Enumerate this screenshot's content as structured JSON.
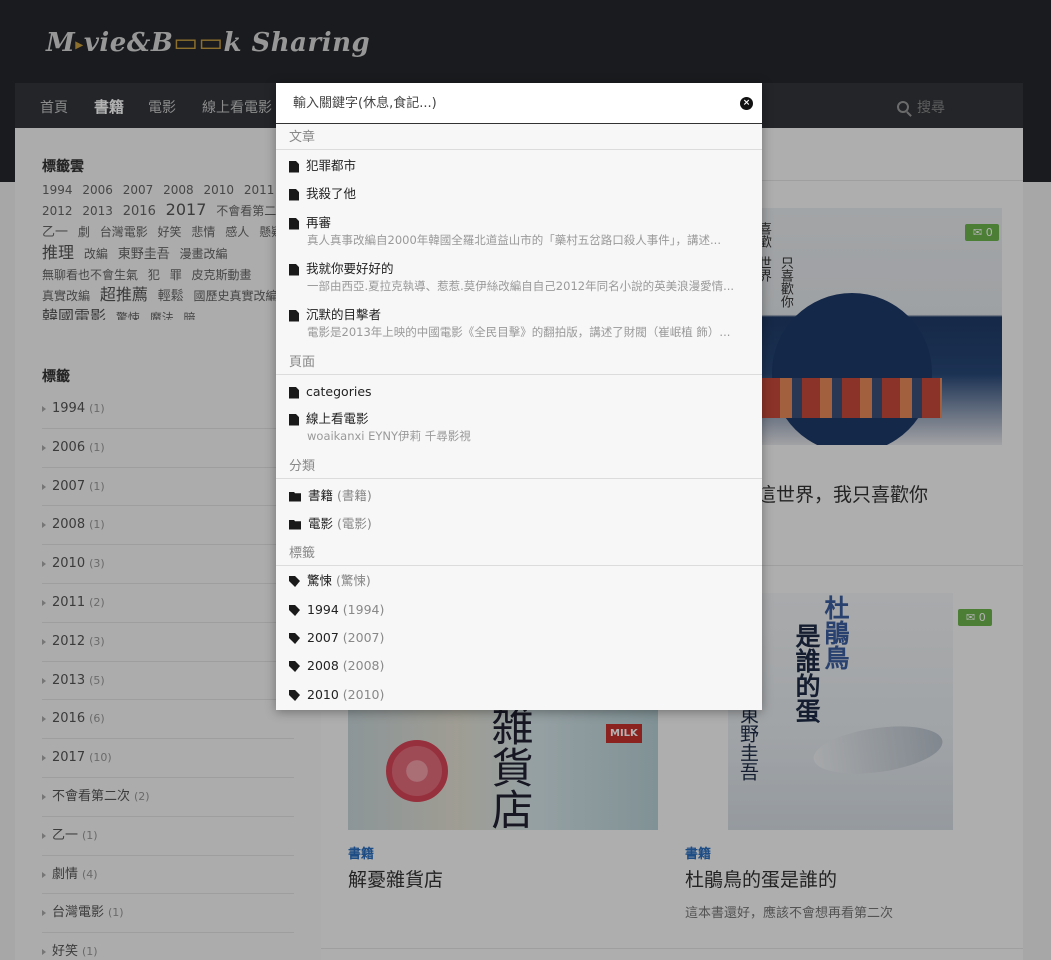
{
  "site": {
    "logo": "M▸vie&B📖k Sharing"
  },
  "nav": {
    "items": [
      "首頁",
      "書籍",
      "電影",
      "線上看電影"
    ],
    "active_index": 1,
    "search_label": "搜尋"
  },
  "sidebar": {
    "tag_cloud_title": "標籤雲",
    "tag_cloud": [
      "1994",
      "2006",
      "2007",
      "2008",
      "2010",
      "2011",
      "2012",
      "2013",
      "2016",
      "2017",
      "不會看第二次",
      "乙一",
      "劇",
      "台灣電影",
      "好笑",
      "悲情",
      "感人",
      "懸疑",
      "推理",
      "改編",
      "東野圭吾",
      "漫畫改編",
      "無聊看也不會生氣",
      "犯",
      "罪",
      "皮克斯動畫",
      "真實改編",
      "超推薦",
      "輕鬆",
      "國歷史真實改編",
      "韓國電影",
      "驚悚",
      "魔法",
      "暗"
    ],
    "tags_title": "標籤",
    "tags": [
      {
        "name": "1994",
        "count": "(1)"
      },
      {
        "name": "2006",
        "count": "(1)"
      },
      {
        "name": "2007",
        "count": "(1)"
      },
      {
        "name": "2008",
        "count": "(1)"
      },
      {
        "name": "2010",
        "count": "(3)"
      },
      {
        "name": "2011",
        "count": "(2)"
      },
      {
        "name": "2012",
        "count": "(3)"
      },
      {
        "name": "2013",
        "count": "(5)"
      },
      {
        "name": "2016",
        "count": "(6)"
      },
      {
        "name": "2017",
        "count": "(10)"
      },
      {
        "name": "不會看第二次",
        "count": "(2)"
      },
      {
        "name": "乙一",
        "count": "(1)"
      },
      {
        "name": "劇情",
        "count": "(4)"
      },
      {
        "name": "台灣電影",
        "count": "(1)"
      },
      {
        "name": "好笑",
        "count": "(1)"
      }
    ]
  },
  "posts": [
    {
      "title": "這世界，我只喜歡你",
      "comments": "0",
      "cover_text": [
        "喜歡",
        "世界",
        "只喜歡你"
      ]
    },
    {
      "category": "書籍",
      "title": "解憂雜貨店",
      "cover_text": [
        "雑貨店",
        "MILK"
      ]
    },
    {
      "category": "書籍",
      "title": "杜鵑鳥的蛋是誰的",
      "excerpt": "這本書還好，應該不會想再看第二次",
      "comments": "0",
      "cover_text": [
        "杜鵑鳥",
        "是誰的蛋",
        "東野圭吾"
      ]
    }
  ],
  "search": {
    "placeholder": "輸入關鍵字(休息,食記...)",
    "close_icon": "×",
    "sections": [
      {
        "heading": "文章",
        "items": [
          {
            "title": "犯罪都市"
          },
          {
            "title": "我殺了他"
          },
          {
            "title": "再審",
            "desc": "真人真事改編自2000年韓國全羅北道益山市的「藥村五岔路口殺人事件」，講述..."
          },
          {
            "title": "我就你要好好的",
            "desc": "一部由西亞.夏拉克執導、惹惹.莫伊絲改編自自己2012年同名小說的英美浪漫愛情..."
          },
          {
            "title": "沉默的目擊者",
            "desc": "電影是2013年上映的中國電影《全民目擊》的翻拍版，講述了財閥（崔岷植 飾）..."
          }
        ]
      },
      {
        "heading": "頁面",
        "items": [
          {
            "title": "categories"
          },
          {
            "title": "線上看電影",
            "desc": "woaikanxi EYNY伊莉 千尋影視"
          }
        ]
      },
      {
        "heading": "分類",
        "items": [
          {
            "title": "書籍",
            "sub": "(書籍)"
          },
          {
            "title": "電影",
            "sub": "(電影)"
          }
        ]
      },
      {
        "heading": "標籤",
        "items": [
          {
            "title": "驚悚",
            "sub": "(驚悚)"
          },
          {
            "title": "1994",
            "sub": "(1994)"
          },
          {
            "title": "2007",
            "sub": "(2007)"
          },
          {
            "title": "2008",
            "sub": "(2008)"
          },
          {
            "title": "2010",
            "sub": "(2010)"
          }
        ]
      }
    ]
  }
}
